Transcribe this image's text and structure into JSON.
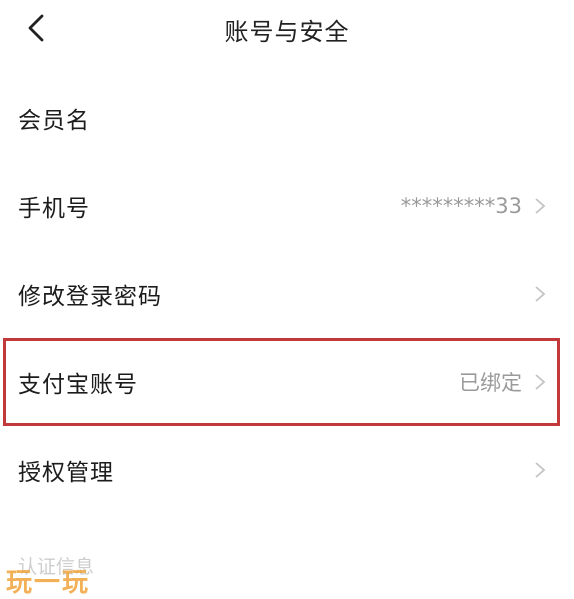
{
  "header": {
    "title": "账号与安全",
    "back_icon": "chevron-left-icon"
  },
  "rows": [
    {
      "label": "会员名",
      "value": "",
      "chevron": false
    },
    {
      "label": "手机号",
      "value": "*********33",
      "chevron": true
    },
    {
      "label": "修改登录密码",
      "value": "",
      "chevron": true
    },
    {
      "label": "支付宝账号",
      "value": "已绑定",
      "chevron": true
    },
    {
      "label": "授权管理",
      "value": "",
      "chevron": true
    }
  ],
  "section": {
    "label": "认证信息"
  },
  "watermark": {
    "text": "玩一玩"
  },
  "colors": {
    "highlight_border": "#c1393b",
    "value_text": "#9a9a9a",
    "watermark": "#f0a43a"
  }
}
